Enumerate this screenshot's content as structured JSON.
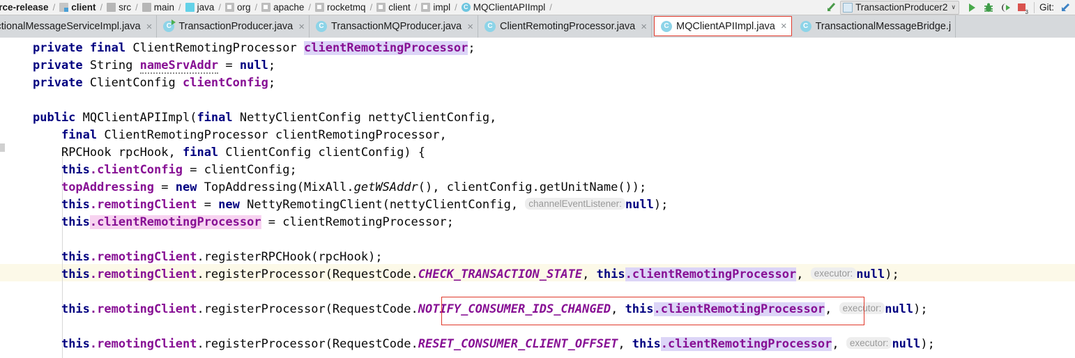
{
  "navbar": {
    "breadcrumbs": [
      {
        "label": "urce-release",
        "icon": "none",
        "bold": true
      },
      {
        "label": "client",
        "icon": "module-icon",
        "bold": true
      },
      {
        "label": "src",
        "icon": "folder-icon",
        "bold": false
      },
      {
        "label": "main",
        "icon": "folder-icon",
        "bold": false
      },
      {
        "label": "java",
        "icon": "source-folder-icon",
        "bold": false
      },
      {
        "label": "org",
        "icon": "package-icon",
        "bold": false
      },
      {
        "label": "apache",
        "icon": "package-icon",
        "bold": false
      },
      {
        "label": "rocketmq",
        "icon": "package-icon",
        "bold": false
      },
      {
        "label": "client",
        "icon": "package-icon",
        "bold": false
      },
      {
        "label": "impl",
        "icon": "package-icon",
        "bold": false
      },
      {
        "label": "MQClientAPIImpl",
        "icon": "class-icon",
        "bold": false
      }
    ],
    "separator": "/",
    "run_configuration": {
      "name": "TransactionProducer2",
      "chevron": "∨"
    },
    "toolbar_buttons": [
      {
        "name": "run-button",
        "icon": "run-triangle-icon"
      },
      {
        "name": "debug-button",
        "icon": "bug-icon"
      },
      {
        "name": "coverage-button",
        "icon": "coverage-icon"
      },
      {
        "name": "stop-button",
        "icon": "stop-square-icon",
        "badge": "3"
      }
    ],
    "git_label": "Git:",
    "git_icon": "update-project-arrow-icon"
  },
  "tabs": [
    {
      "label": "ansactionalMessageServiceImpl.java",
      "icon": "java-class-icon",
      "active": false,
      "close": "×"
    },
    {
      "label": "TransactionProducer.java",
      "icon": "java-class-runnable-icon",
      "active": false,
      "close": "×"
    },
    {
      "label": "TransactionMQProducer.java",
      "icon": "java-class-icon",
      "active": false,
      "close": "×"
    },
    {
      "label": "ClientRemotingProcessor.java",
      "icon": "java-class-icon",
      "active": false,
      "close": "×"
    },
    {
      "label": "MQClientAPIImpl.java",
      "icon": "java-class-icon",
      "active": true,
      "close": "×"
    },
    {
      "label": "TransactionalMessageBridge.j",
      "icon": "java-class-icon",
      "active": false,
      "close": ""
    }
  ],
  "editor": {
    "language": "java",
    "class_letter": "C",
    "highlight_colors": {
      "caret_line": "#fcf9e8",
      "identifier_read": "#dcd5f7",
      "identifier_write": "#f7d3f0",
      "search_box_border": "#e0392b",
      "keyword": "#000080",
      "field": "#871094",
      "hint_background": "#eeeeee",
      "hint_text": "#999999"
    },
    "lines": {
      "l1": {
        "kw1": "private",
        "kw2": "final",
        "type": "ClientRemotingProcessor",
        "name": "clientRemotingProcessor",
        "semi": ";"
      },
      "l2": {
        "kw1": "private",
        "type": "String",
        "name": "nameSrvAddr",
        "eq": " = ",
        "val": "null",
        "semi": ";"
      },
      "l3": {
        "kw1": "private",
        "type": "ClientConfig",
        "name": "clientConfig",
        "semi": ";"
      },
      "l5": {
        "kw1": "public",
        "ctor": "MQClientAPIImpl(",
        "kw2": "final",
        "ptype": "NettyClientConfig",
        "pname": "nettyClientConfig,",
        "full": "    public MQClientAPIImpl(final NettyClientConfig nettyClientConfig,"
      },
      "l6": {
        "kw": "final",
        "ptype": "ClientRemotingProcessor",
        "pname": "clientRemotingProcessor,"
      },
      "l7": {
        "ptype1": "RPCHook",
        "pname1": "rpcHook, ",
        "kw": "final",
        "ptype2": "ClientConfig",
        "pname2": "clientConfig) {"
      },
      "l8": {
        "kw": "this",
        "dot": ".",
        "fld": "clientConfig",
        "rest": " = clientConfig;"
      },
      "l9": {
        "fld": "topAddressing",
        "eq": " = ",
        "kw": "new",
        "rest1": " TopAddressing(MixAll.",
        "smth": "getWSAddr",
        "rest2": "(), clientConfig.getUnitName());"
      },
      "l10": {
        "kw1": "this",
        "dot": ".",
        "fld": "remotingClient",
        "eq": " = ",
        "kw2": "new",
        "rest1": " NettyRemotingClient(nettyClientConfig, ",
        "hint": "channelEventListener:",
        "val": "null",
        "rest2": ");"
      },
      "l11": {
        "kw": "this",
        "dot": ".",
        "fld": "clientRemotingProcessor",
        "rest": " = clientRemotingProcessor;"
      },
      "l13": {
        "kw": "this",
        "dot": ".",
        "fld": "remotingClient",
        "mid": ".registerRPCHook(rpcHook);"
      },
      "l14": {
        "kw": "this",
        "dot": ".",
        "fld": "remotingClient",
        "mid": ".registerProcessor(RequestCode.",
        "const": "CHECK_TRANSACTION_STATE",
        "sep": ", ",
        "kw2": "this",
        "dot2": ".",
        "fld2": "clientRemotingProcessor",
        "comma": ",",
        "hint": "executor:",
        "val": "null",
        "end": ");"
      },
      "l16": {
        "kw": "this",
        "dot": ".",
        "fld": "remotingClient",
        "mid": ".registerProcessor(RequestCode.",
        "const": "NOTIFY_CONSUMER_IDS_CHANGED",
        "sep": ", ",
        "kw2": "this",
        "dot2": ".",
        "fld2": "clientRemotingProcessor",
        "comma": ",",
        "hint": "executor:",
        "val": "null",
        "end": ");"
      },
      "l18": {
        "kw": "this",
        "dot": ".",
        "fld": "remotingClient",
        "mid": ".registerProcessor(RequestCode.",
        "const": "RESET_CONSUMER_CLIENT_OFFSET",
        "sep": ", ",
        "kw2": "this",
        "dot2": ".",
        "fld2": "clientRemotingProcessor",
        "comma": ",",
        "hint": "executor:",
        "val": "null",
        "end": ");"
      }
    }
  }
}
